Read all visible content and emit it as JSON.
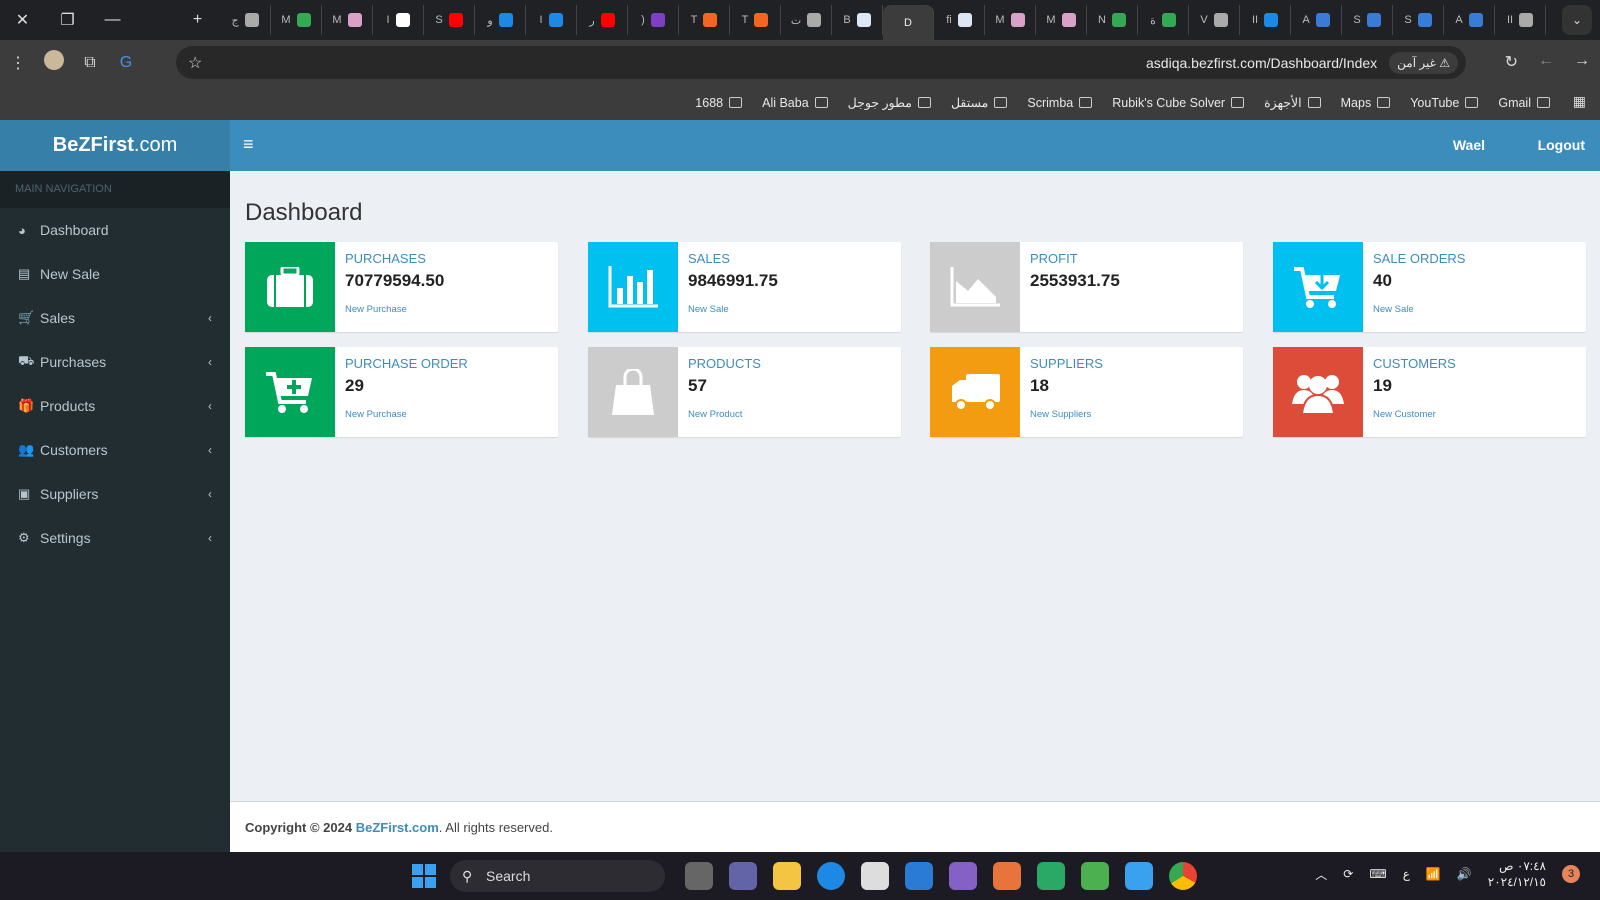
{
  "browser": {
    "window_controls": {
      "close": "✕",
      "restore": "❐",
      "minimize": "—",
      "new_tab": "+"
    },
    "tabs": [
      {
        "label": "ج",
        "color": "#aaaaaa"
      },
      {
        "label": "M",
        "color": "#34a853"
      },
      {
        "label": "M",
        "color": "#d9a0c8"
      },
      {
        "label": "I",
        "color": "#ffffff"
      },
      {
        "label": "S",
        "color": "#ff0000"
      },
      {
        "label": "و",
        "color": "#1e88e5"
      },
      {
        "label": "I",
        "color": "#1e88e5"
      },
      {
        "label": "ر",
        "color": "#ff0000"
      },
      {
        "label": ")",
        "color": "#7e3fc2"
      },
      {
        "label": "T",
        "color": "#f26522"
      },
      {
        "label": "T",
        "color": "#f26522"
      },
      {
        "label": "ت",
        "color": "#aaaaaa"
      },
      {
        "label": "B",
        "color": "#dde6f5"
      },
      {
        "label": "D",
        "color": "#3c3c3c",
        "active": true
      },
      {
        "label": "fi",
        "color": "#dde6f5"
      },
      {
        "label": "M",
        "color": "#d9a0c8"
      },
      {
        "label": "M",
        "color": "#d9a0c8"
      },
      {
        "label": "N",
        "color": "#34a853"
      },
      {
        "label": "ة",
        "color": "#34a853"
      },
      {
        "label": "V",
        "color": "#aaaaaa"
      },
      {
        "label": "II",
        "color": "#1e88e5"
      },
      {
        "label": "A",
        "color": "#3a7bd5"
      },
      {
        "label": "S",
        "color": "#3a7bd5"
      },
      {
        "label": "S",
        "color": "#3a7bd5"
      },
      {
        "label": "A",
        "color": "#3a7bd5"
      },
      {
        "label": "II",
        "color": "#aaaaaa"
      }
    ],
    "url": "asdiqa.bezfirst.com/Dashboard/Index",
    "security_label": "غير آمن",
    "bookmarks": [
      {
        "label": "1688"
      },
      {
        "label": "Ali Baba"
      },
      {
        "label": "مطور جوجل"
      },
      {
        "label": "مستقل"
      },
      {
        "label": "Scrimba"
      },
      {
        "label": "Rubik's Cube Solver"
      },
      {
        "label": "الأجهزة"
      },
      {
        "label": "Maps"
      },
      {
        "label": "YouTube"
      },
      {
        "label": "Gmail"
      }
    ]
  },
  "app": {
    "logo_bold": "BeZFirst",
    "logo_rest": ".com",
    "user": "Wael",
    "logout": "Logout",
    "sidebar": {
      "header": "MAIN NAVIGATION",
      "items": [
        {
          "label": "Dashboard",
          "icon": "dashboard-icon",
          "glyph": "◕",
          "submenu": false
        },
        {
          "label": "New Sale",
          "icon": "file-icon",
          "glyph": "▤",
          "submenu": false
        },
        {
          "label": "Sales",
          "icon": "cart-icon",
          "glyph": "🛒",
          "submenu": true
        },
        {
          "label": "Purchases",
          "icon": "truck-icon",
          "glyph": "⛟",
          "submenu": true
        },
        {
          "label": "Products",
          "icon": "gift-icon",
          "glyph": "🎁",
          "submenu": true
        },
        {
          "label": "Customers",
          "icon": "users-icon",
          "glyph": "👥",
          "submenu": true
        },
        {
          "label": "Suppliers",
          "icon": "address-book-icon",
          "glyph": "▣",
          "submenu": true
        },
        {
          "label": "Settings",
          "icon": "gear-icon",
          "glyph": "⚙",
          "submenu": true
        }
      ]
    },
    "page_title": "Dashboard",
    "boxes": [
      {
        "title": "Purchases",
        "value": "70779594.50",
        "link": "New Purchase",
        "color": "#00a65a",
        "icon": "briefcase-icon"
      },
      {
        "title": "Sales",
        "value": "9846991.75",
        "link": "New Sale",
        "color": "#00c0ef",
        "icon": "bar-chart-icon"
      },
      {
        "title": "Profit",
        "value": "2553931.75",
        "link": "",
        "color": "#cccccc",
        "icon": "area-chart-icon"
      },
      {
        "title": "Sale Orders",
        "value": "40",
        "link": "New Sale",
        "color": "#00c0ef",
        "icon": "cart-download-icon"
      },
      {
        "title": "Purchase Order",
        "value": "29",
        "link": "New Purchase",
        "color": "#00a65a",
        "icon": "cart-plus-icon"
      },
      {
        "title": "Products",
        "value": "57",
        "link": "New Product",
        "color": "#cccccc",
        "icon": "shopping-bag-icon"
      },
      {
        "title": "Suppliers",
        "value": "18",
        "link": "New Suppliers",
        "color": "#f39c12",
        "icon": "truck-icon"
      },
      {
        "title": "Customers",
        "value": "19",
        "link": "New Customer",
        "color": "#dd4b39",
        "icon": "users-icon"
      }
    ],
    "footer": {
      "prefix": "Copyright © 2024 ",
      "link": "BeZFirst.com",
      "suffix": ". All rights reserved."
    }
  },
  "taskbar": {
    "search": "Search",
    "time": "٠٧:٤٨ ص",
    "date": "٢٠٢٤/١٢/١٥",
    "language": "ع",
    "notifications": "3"
  }
}
